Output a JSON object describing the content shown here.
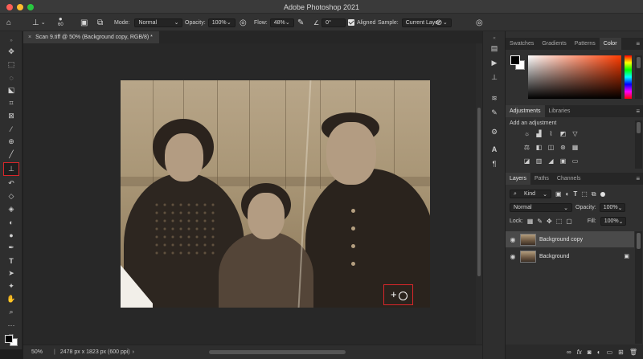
{
  "window": {
    "title": "Adobe Photoshop 2021"
  },
  "options": {
    "brush_size": "60",
    "mode_label": "Mode:",
    "mode_value": "Normal",
    "opacity_label": "Opacity:",
    "opacity_value": "100%",
    "flow_label": "Flow:",
    "flow_value": "48%",
    "angle_value": "0°",
    "aligned_label": "Aligned",
    "sample_label": "Sample:",
    "sample_value": "Current Layer"
  },
  "document": {
    "tab_title": "Scan 9.tiff @ 50% (Background copy, RGB/8) *"
  },
  "status": {
    "zoom": "50%",
    "doc_info": "2478 px x 1823 px (600 ppi)"
  },
  "panels": {
    "color_tabs": [
      "Swatches",
      "Gradients",
      "Patterns",
      "Color"
    ],
    "adjust_tabs": [
      "Adjustments",
      "Libraries"
    ],
    "add_adjustment": "Add an adjustment",
    "layer_tabs": [
      "Layers",
      "Paths",
      "Channels"
    ]
  },
  "layers_panel": {
    "kind_filter": "Kind",
    "blend_mode": "Normal",
    "opacity_label": "Opacity:",
    "opacity_value": "100%",
    "lock_label": "Lock:",
    "fill_label": "Fill:",
    "fill_value": "100%",
    "layers": [
      {
        "name": "Background copy",
        "selected": true
      },
      {
        "name": "Background",
        "selected": false,
        "locked": true
      }
    ]
  },
  "icons": {
    "close": "×",
    "chevron": "⌄",
    "menu": "≡",
    "eye": "◉",
    "lock": "🔒"
  },
  "colors": {
    "accent_highlight": "#d8262a",
    "close_dot": "#fe5f57",
    "min_dot": "#febc2e",
    "max_dot": "#28c840"
  }
}
